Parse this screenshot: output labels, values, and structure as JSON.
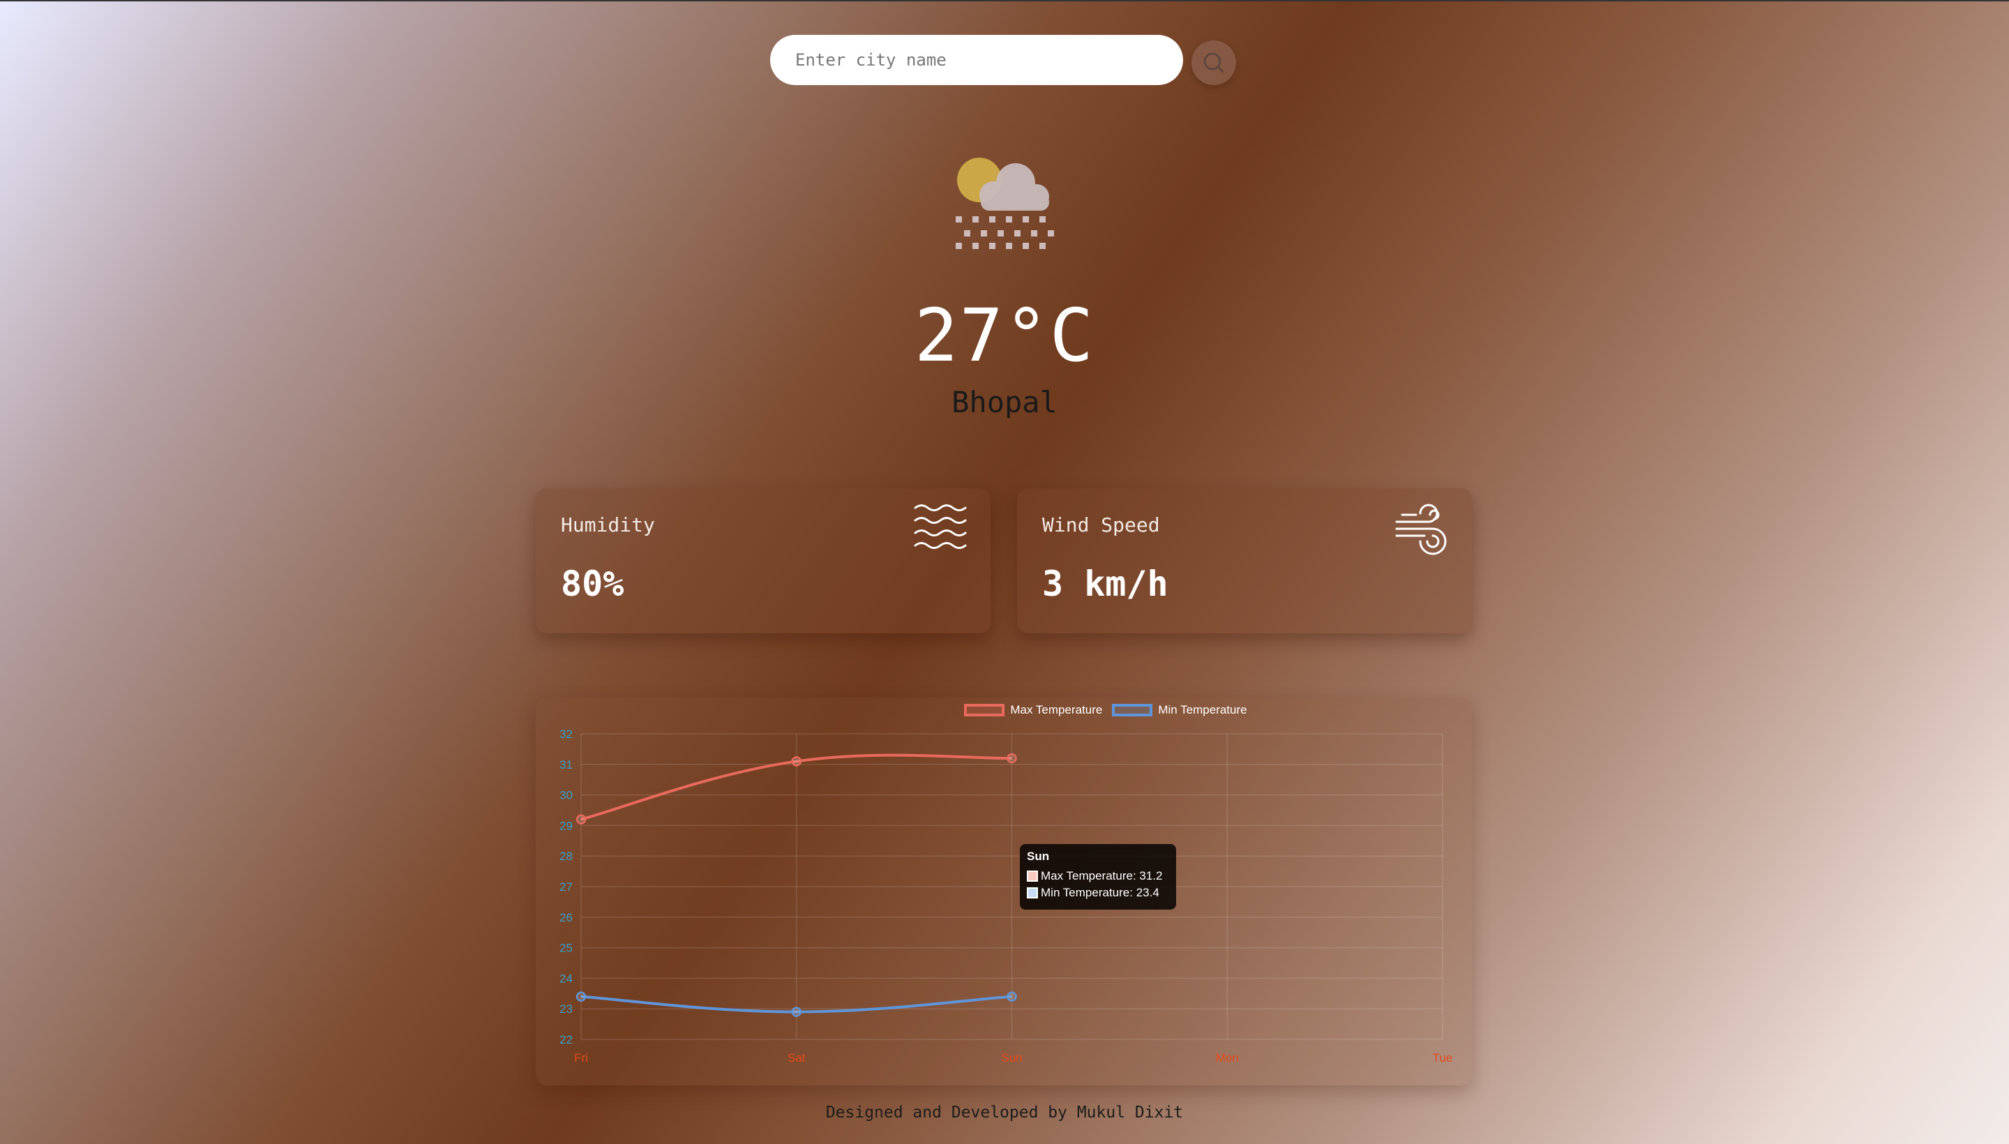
{
  "search": {
    "placeholder": "Enter city name",
    "value": ""
  },
  "weather": {
    "icon": "sun-cloud-snow-icon",
    "temperature": "27°C",
    "city": "Bhopal"
  },
  "humidity": {
    "label": "Humidity",
    "value": "80%",
    "icon": "waves-icon"
  },
  "wind": {
    "label": "Wind Speed",
    "value": "3 km/h",
    "icon": "wind-icon"
  },
  "chart_data": {
    "type": "line",
    "categories": [
      "Fri",
      "Sat",
      "Sun",
      "Mon",
      "Tue"
    ],
    "series": [
      {
        "name": "Max Temperature",
        "values": [
          29.2,
          31.1,
          31.2
        ],
        "color": "#e86a5c"
      },
      {
        "name": "Min Temperature",
        "values": [
          23.4,
          22.9,
          23.4
        ],
        "color": "#5f95d9"
      }
    ],
    "ylim": [
      22,
      32
    ],
    "yticks": [
      22,
      23,
      24,
      25,
      26,
      27,
      28,
      29,
      30,
      31,
      32
    ],
    "tick_color_y": "#3aa0c8",
    "tick_color_x": "#e64a19",
    "legend": "top-center",
    "grid": true
  },
  "tooltip": {
    "title": "Sun",
    "rows": [
      "Max Temperature: 31.2",
      "Min Temperature: 23.4"
    ]
  },
  "footer": {
    "text": "Designed and Developed by Mukul Dixit"
  }
}
